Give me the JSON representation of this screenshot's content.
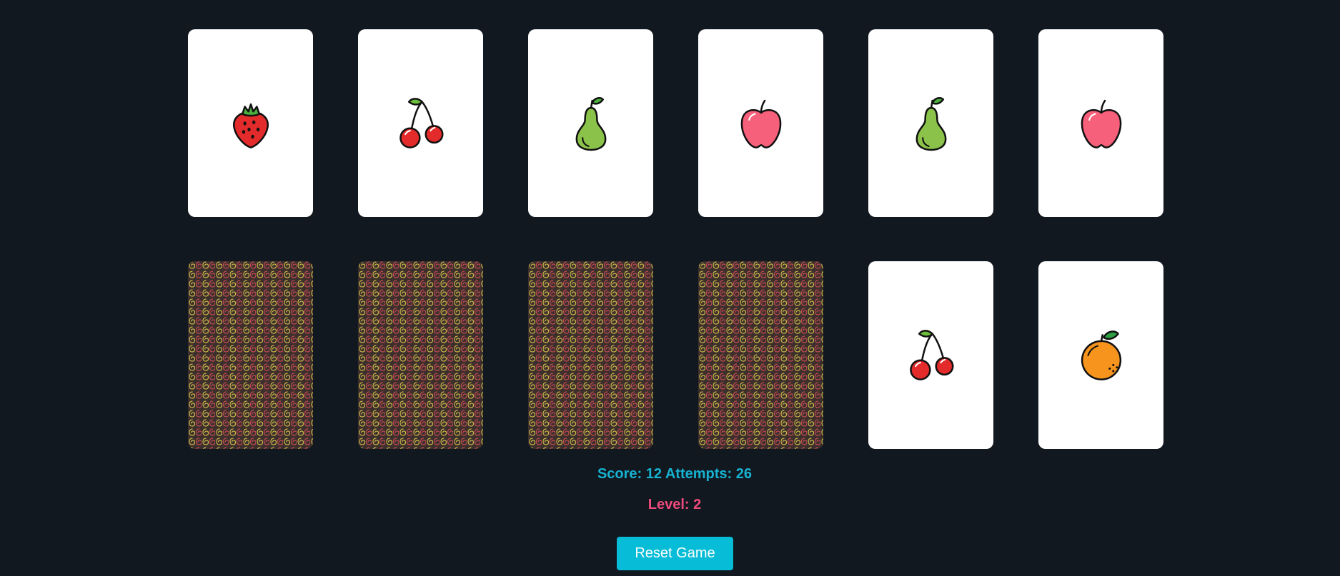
{
  "cards": [
    {
      "state": "face-up",
      "fruit": "strawberry-icon"
    },
    {
      "state": "face-up",
      "fruit": "cherry-icon"
    },
    {
      "state": "face-up",
      "fruit": "pear-icon"
    },
    {
      "state": "face-up",
      "fruit": "apple-icon"
    },
    {
      "state": "face-up",
      "fruit": "pear-icon"
    },
    {
      "state": "face-up",
      "fruit": "apple-icon"
    },
    {
      "state": "face-down",
      "fruit": null
    },
    {
      "state": "face-down",
      "fruit": null
    },
    {
      "state": "face-down",
      "fruit": null
    },
    {
      "state": "face-down",
      "fruit": null
    },
    {
      "state": "face-up",
      "fruit": "cherry-icon"
    },
    {
      "state": "face-up",
      "fruit": "orange-icon"
    }
  ],
  "stats": {
    "score_label": "Score:",
    "score": "12",
    "attempts_label": "Attempts:",
    "attempts": "26",
    "level_label": "Level:",
    "level": "2"
  },
  "controls": {
    "reset_label": "Reset Game"
  },
  "colors": {
    "background": "#111820",
    "score_text": "#17b3d1",
    "level_text": "#ef4a7d",
    "button": "#06bcd7",
    "card_face": "#ffffff",
    "card_back": "#3d2f2b",
    "swirl_yellow": "#c9b84a",
    "swirl_red": "#c24a55"
  }
}
